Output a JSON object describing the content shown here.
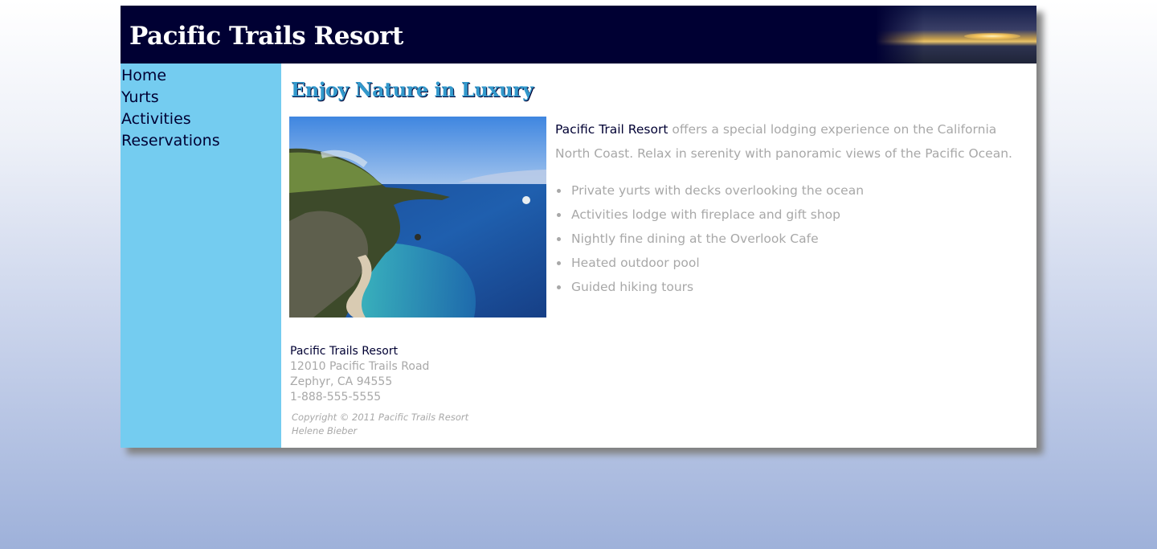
{
  "header": {
    "title": "Pacific Trails Resort"
  },
  "nav": {
    "items": [
      {
        "label": "Home"
      },
      {
        "label": "Yurts"
      },
      {
        "label": "Activities"
      },
      {
        "label": "Reservations"
      }
    ]
  },
  "main": {
    "heading": "Enjoy Nature in Luxury",
    "hero_image": "ocean-cliff-coastline-photo",
    "intro": {
      "brand": "Pacific Trail Resort",
      "text": " offers a special lodging experience on the California North Coast. Relax in serenity with panoramic views of the Pacific Ocean."
    },
    "features": [
      "Private yurts with decks overlooking the ocean",
      "Activities lodge with fireplace and gift shop",
      "Nightly fine dining at the Overlook Cafe",
      "Heated outdoor pool",
      "Guided hiking tours"
    ],
    "contact": {
      "name": "Pacific Trails Resort",
      "street": "12010 Pacific Trails Road",
      "city": "Zephyr, CA 94555",
      "phone": "1-888-555-5555"
    }
  },
  "footer": {
    "copyright": "Copyright © 2011 Pacific Trails Resort",
    "author": "Helene Bieber"
  },
  "colors": {
    "header_bg": "#000033",
    "nav_bg": "#74ccf0",
    "heading": "#3399cc",
    "body_text": "#a8a8a8"
  }
}
